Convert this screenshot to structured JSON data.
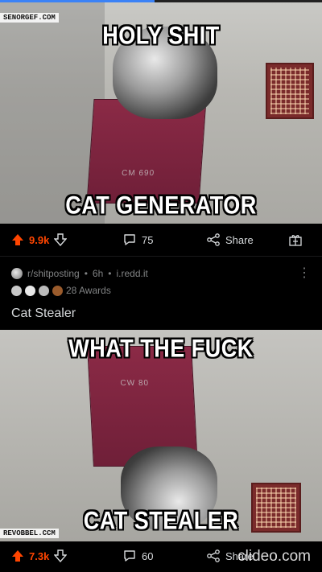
{
  "progress": {
    "fraction": 0.48
  },
  "post1": {
    "watermark": "SENORGEF.COM",
    "meme_top": "HOLY SHIT",
    "meme_bottom": "CAT GENERATOR",
    "box_label": "CM 690",
    "upvotes": "9.9k",
    "comments": "75",
    "share_label": "Share"
  },
  "post2": {
    "subreddit": "r/shitposting",
    "time": "6h",
    "domain": "i.redd.it",
    "awards_label": "28 Awards",
    "title": "Cat Stealer",
    "meme_top": "WHAT THE FUCK",
    "meme_bottom": "CAT STEALER",
    "box_label": "CW 80",
    "watermark": "REVOBBEL.CCM",
    "upvotes": "7.3k",
    "comments": "60",
    "share_label": "Share"
  },
  "overlay": {
    "clideo": "clideo.com"
  },
  "colors": {
    "upvote": "#ff4500",
    "accent": "#3b82f6",
    "text": "#d7dadc",
    "muted": "#818384"
  },
  "icons": [
    "upvote-arrow-icon",
    "downvote-arrow-icon",
    "comment-icon",
    "share-icon",
    "award-gift-icon",
    "more-options-icon"
  ]
}
